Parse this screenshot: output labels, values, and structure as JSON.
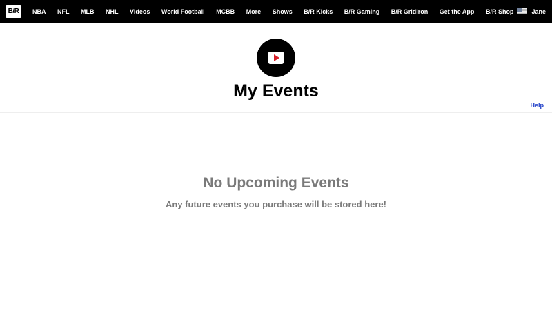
{
  "topbar": {
    "logo_text": "B/R",
    "nav_items": [
      "NBA",
      "NFL",
      "MLB",
      "NHL",
      "Videos",
      "World Football",
      "MCBB",
      "More",
      "Shows",
      "B/R Kicks",
      "B/R Gaming",
      "B/R Gridiron",
      "Get the App",
      "B/R Shop"
    ],
    "user_name": "Jane"
  },
  "header": {
    "title": "My Events",
    "help_label": "Help"
  },
  "empty_state": {
    "title": "No Upcoming Events",
    "subtitle": "Any future events you purchase will be stored here!"
  },
  "colors": {
    "topbar_bg": "#000000",
    "help_link": "#1f3ec8",
    "play_accent": "#d6202a",
    "muted_text": "#7a7a7a"
  }
}
